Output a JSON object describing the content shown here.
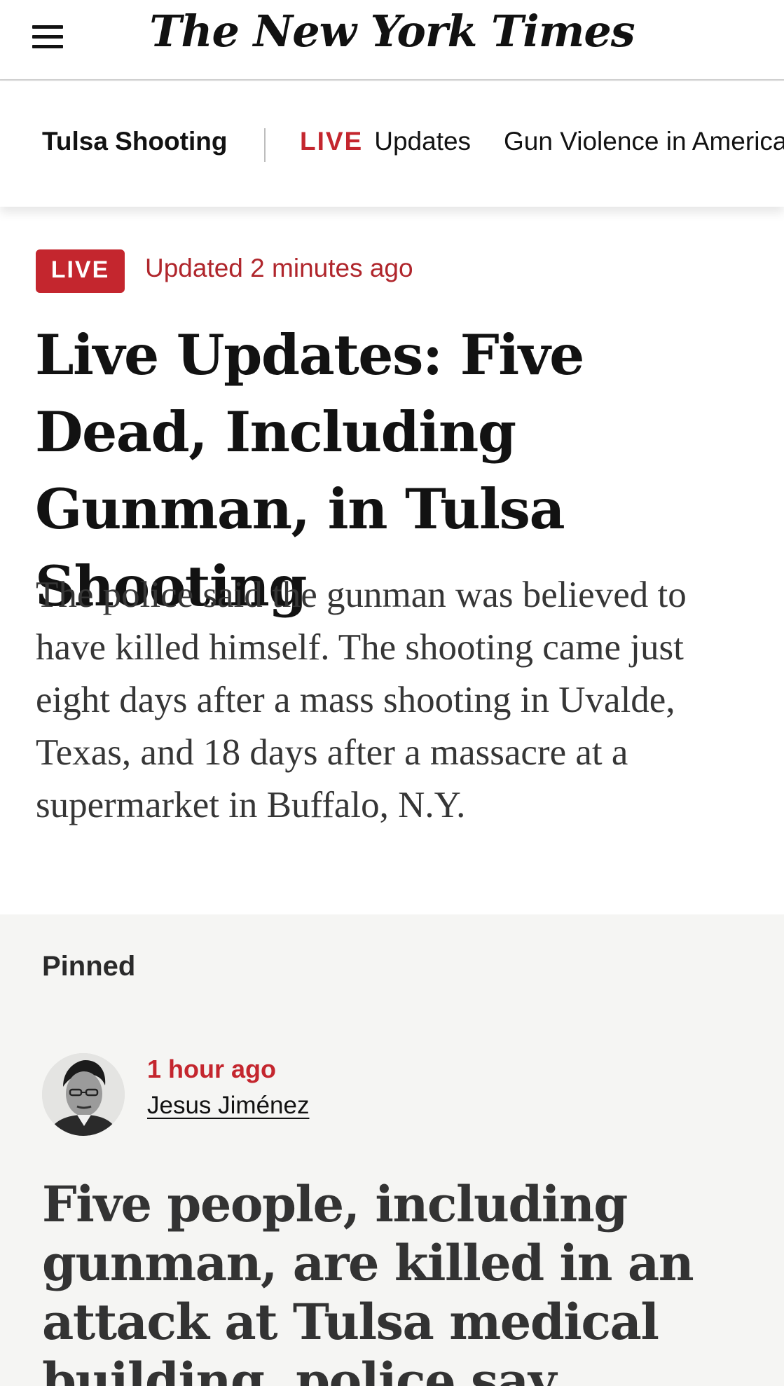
{
  "masthead": {
    "logo_text": "The New York Times",
    "menu_icon": "hamburger-menu-icon"
  },
  "section_nav": {
    "title": "Tulsa Shooting",
    "live_label": "LIVE",
    "updates_label": "Updates",
    "gun_violence_label": "Gun Violence in America"
  },
  "article": {
    "live_badge": "LIVE",
    "updated_text": "Updated 2 minutes ago",
    "headline": "Live Updates: Five Dead, Including Gunman, in Tulsa Shooting",
    "summary": "The police said the gunman was believed to have killed himself. The shooting came just eight days after a mass shooting in Uvalde, Texas, and 18 days after a massacre at a supermarket in Buffalo, N.Y."
  },
  "pinned": {
    "label": "Pinned",
    "time_ago": "1 hour ago",
    "author": "Jesus Jiménez",
    "headline": "Five people, including gunman, are killed in an attack at Tulsa medical building, police say."
  },
  "colors": {
    "accent_red": "#c4262e",
    "pinned_background": "#f5f5f3",
    "text_dark": "#121212"
  }
}
